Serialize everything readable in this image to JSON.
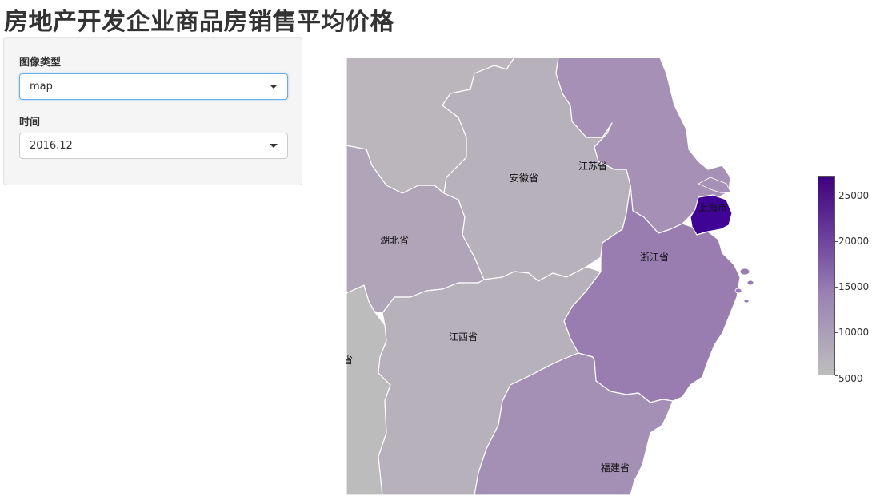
{
  "page": {
    "title": "房地产开发企业商品房销售平均价格"
  },
  "controls": {
    "chart_type_label": "图像类型",
    "chart_type_value": "map",
    "time_label": "时间",
    "time_value": "2016.12"
  },
  "map": {
    "provinces": [
      {
        "name": "安徽省",
        "fill": "#b7b1bb"
      },
      {
        "name": "江苏省",
        "fill": "#a690b5"
      },
      {
        "name": "上海市",
        "fill": "#3f0395"
      },
      {
        "name": "浙江省",
        "fill": "#997db1"
      },
      {
        "name": "湖北省",
        "fill": "#b0a4b9"
      },
      {
        "name": "江西省",
        "fill": "#b7b1bb"
      },
      {
        "name": "福建省",
        "fill": "#a590b5"
      },
      {
        "name": "湖南省",
        "fill": "#bdbcbd",
        "visible_label": "省"
      }
    ],
    "legend": {
      "min": 5000,
      "max": 27000,
      "ticks": [
        "25000",
        "20000",
        "15000",
        "10000",
        "5000"
      ],
      "color_low": "#bdbdbd",
      "color_high": "#3f007d"
    }
  }
}
